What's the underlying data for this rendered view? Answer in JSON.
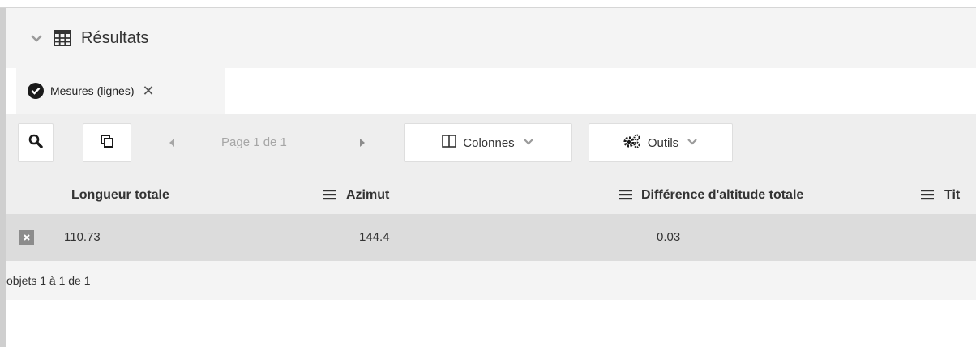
{
  "panel": {
    "title": "Résultats"
  },
  "tab": {
    "label": "Mesures (lignes)",
    "close_glyph": "✕"
  },
  "toolbar": {
    "pager_text": "Page 1 de 1",
    "columns_label": "Colonnes",
    "tools_label": "Outils"
  },
  "columns": [
    {
      "label": "Longueur totale"
    },
    {
      "label": "Azimut"
    },
    {
      "label": "Différence d'altitude totale"
    },
    {
      "label": "Tit"
    }
  ],
  "rows": [
    {
      "cells": [
        "110.73",
        "144.4",
        "0.03"
      ]
    }
  ],
  "footer": {
    "count_text": "objets 1 à 1 de 1"
  },
  "icons": [
    "chevron-down-icon",
    "table-grid-icon",
    "check-circle-icon",
    "close-icon",
    "search-icon",
    "copy-icon",
    "prev-page-icon",
    "next-page-icon",
    "columns-icon",
    "gears-icon",
    "column-menu-icon",
    "row-remove-icon"
  ],
  "colors": {
    "header_bg": "#f4f4f4",
    "toolbar_bg": "#eeeeee",
    "row_bg": "#dcdcdc",
    "text": "#333333",
    "muted": "#a6a6a6"
  }
}
